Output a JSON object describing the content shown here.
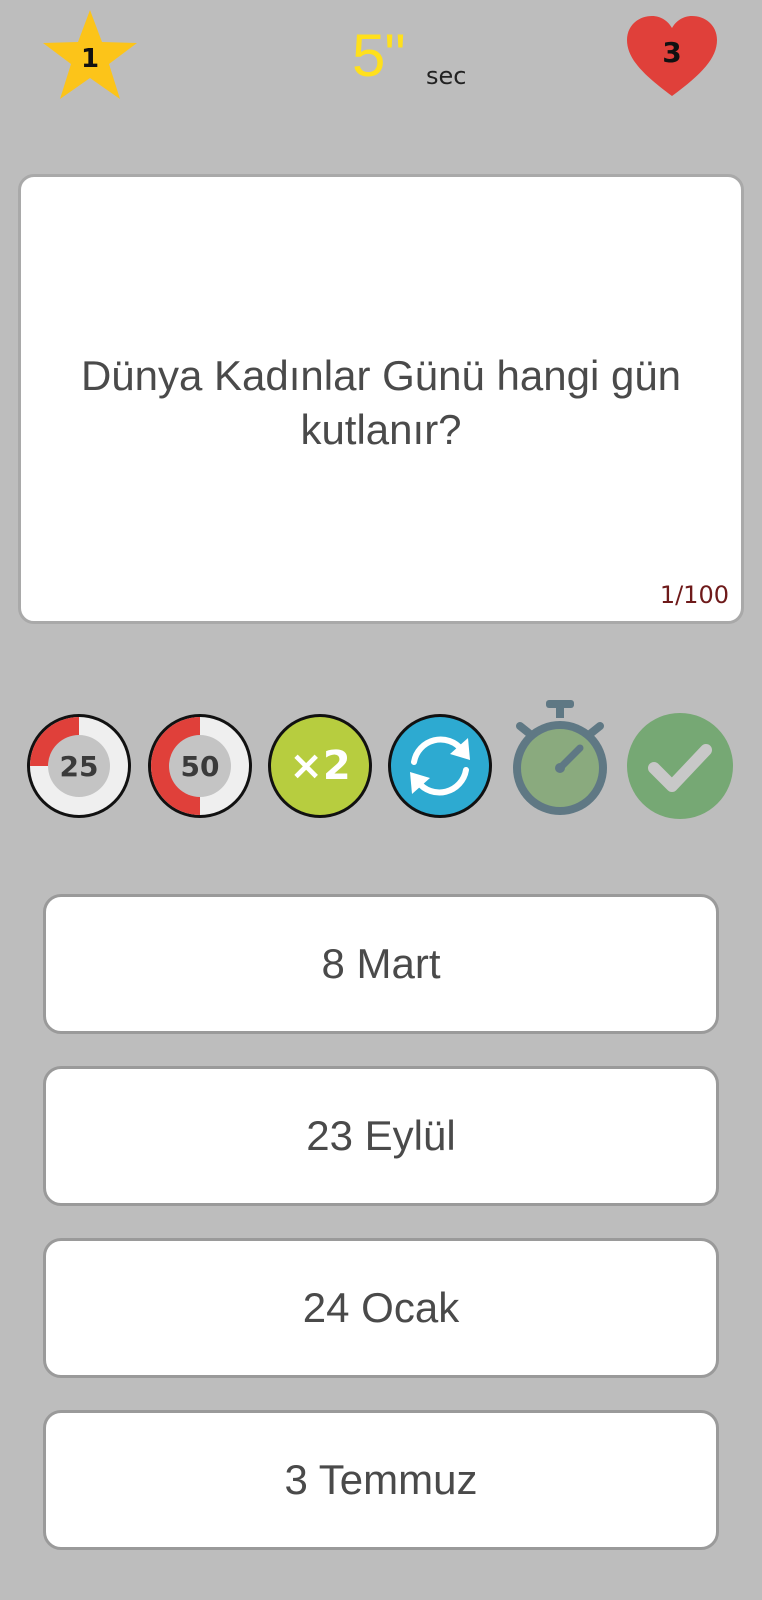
{
  "header": {
    "score": "1",
    "timer_value": "5\"",
    "timer_unit": "sec",
    "lives": "3",
    "icons": {
      "score": "star-icon",
      "lives": "heart-icon"
    }
  },
  "question": {
    "text": "Dünya Kadınlar Günü hangi gün kutlanır?",
    "counter": "1/100"
  },
  "jokers": [
    {
      "name": "joker-25",
      "label": "25",
      "icon": "percent-25-icon"
    },
    {
      "name": "joker-50",
      "label": "50",
      "icon": "fifty-fifty-icon"
    },
    {
      "name": "joker-x2",
      "label": "×2",
      "icon": "double-answer-icon"
    },
    {
      "name": "joker-swap",
      "label": "",
      "icon": "swap-question-icon"
    },
    {
      "name": "joker-time",
      "label": "",
      "icon": "stopwatch-icon"
    },
    {
      "name": "joker-check",
      "label": "",
      "icon": "checkmark-icon"
    }
  ],
  "answers": [
    {
      "text": "8 Mart"
    },
    {
      "text": "23 Eylül"
    },
    {
      "text": "24 Ocak"
    },
    {
      "text": "3 Temmuz"
    }
  ],
  "colors": {
    "background": "#bdbdbd",
    "star": "#fcc419",
    "heart": "#e0403a",
    "timer": "#ffe01c",
    "joker_red": "#e0403a",
    "joker_green": "#b7cd3f",
    "joker_blue": "#2daad1",
    "joker_time": "#5f7884",
    "joker_check": "#76a874"
  }
}
